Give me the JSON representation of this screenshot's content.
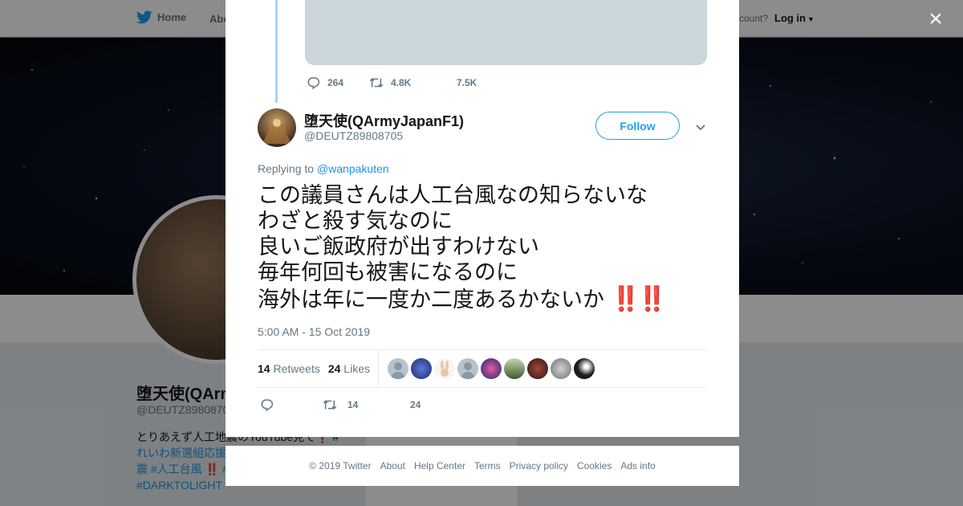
{
  "background_page": {
    "nav": {
      "home_label": "Home",
      "about_label": "Abo",
      "account_prompt": "ccount?",
      "login_label": "Log in"
    },
    "profile": {
      "name": "堕天使(QArm",
      "handle": "@DEUTZ8980870",
      "bio_line1": "とりあえず人工地震のYouTube見て❗ #",
      "bio_line2_tag": "れいわ新選組応援",
      "bio_line3": "震 #人工台風 ‼️ #",
      "bio_line4_tag": "#DARKTOLIGHT"
    }
  },
  "modal": {
    "close_label": "×",
    "previous_tweet_actions": {
      "replies": "264",
      "retweets": "4.8K",
      "likes": "7.5K"
    },
    "tweet": {
      "author_name": "堕天使(QArmyJapanF1)",
      "author_handle": "@DEUTZ89808705",
      "follow_label": "Follow",
      "replying_prefix": "Replying to",
      "replying_to": "@wanpakuten",
      "text_lines": [
        "この議員さんは人工台風なの知らないな",
        "わざと殺す気なのに",
        "良いご飯政府が出すわけない",
        "毎年何回も被害になるのに",
        "海外は年に一度か二度あるかないか"
      ],
      "emoji_suffix": "‼️‼️",
      "timestamp": "5:00 AM - 15 Oct 2019",
      "retweet_count": "14",
      "retweet_label": "Retweets",
      "like_count": "24",
      "like_label": "Likes",
      "action_retweets": "14",
      "action_likes": "24"
    }
  },
  "footer": {
    "copyright": "© 2019 Twitter",
    "links": [
      "About",
      "Help Center",
      "Terms",
      "Privacy policy",
      "Cookies",
      "Ads info"
    ]
  },
  "colors": {
    "accent": "#1da1f2",
    "link": "#1b95e0",
    "muted": "#657786",
    "emoji_red": "#e0182a"
  }
}
